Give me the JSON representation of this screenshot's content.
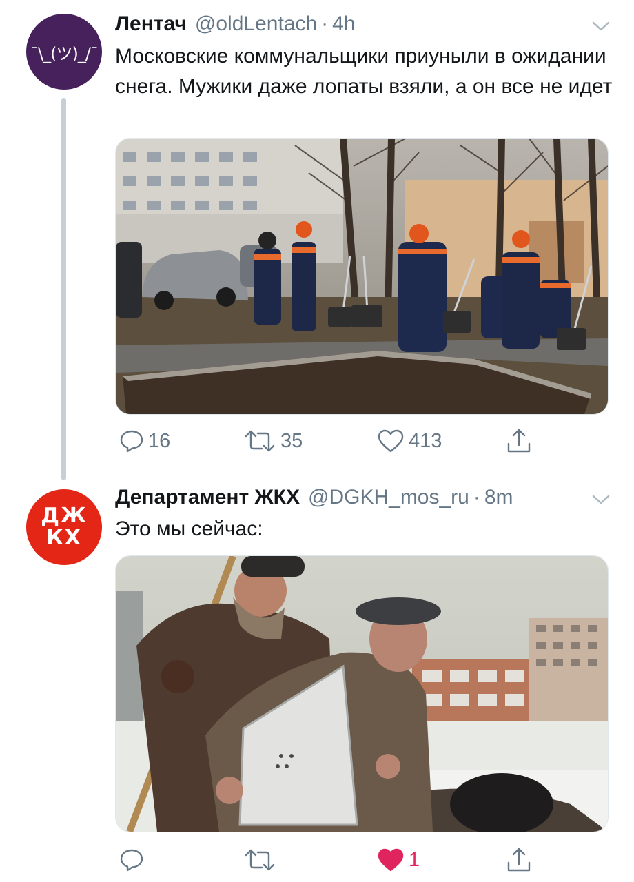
{
  "tweets": [
    {
      "author_name": "Лентач",
      "handle": "@oldLentach",
      "separator": "·",
      "time": "4h",
      "avatar_text": "¯\\_(ツ)_/¯",
      "text": "Московские коммунальщики приуныли в ожидании снега. Мужики даже лопаты взяли, а он все не идет",
      "media_description": "photo",
      "replies": "16",
      "retweets": "35",
      "likes": "413",
      "liked": false
    },
    {
      "author_name": "Департамент ЖКХ",
      "handle": "@DGKH_mos_ru",
      "separator": "·",
      "time": "8m",
      "avatar_line1": "ДЖ",
      "avatar_line2": "КХ",
      "text": "Это мы сейчас:",
      "media_description": "photo",
      "replies": "",
      "retweets": "",
      "likes": "1",
      "liked": true
    }
  ],
  "icons": {
    "reply": "reply-icon",
    "retweet": "retweet-icon",
    "like": "heart-icon",
    "share": "share-icon",
    "caret": "chevron-down-icon"
  },
  "colors": {
    "secondary_text": "#657786",
    "like_active": "#e0245e",
    "lentach_avatar_bg": "#46215c",
    "dgkh_avatar_bg": "#e42617",
    "thread_line": "#c4cfd6"
  }
}
